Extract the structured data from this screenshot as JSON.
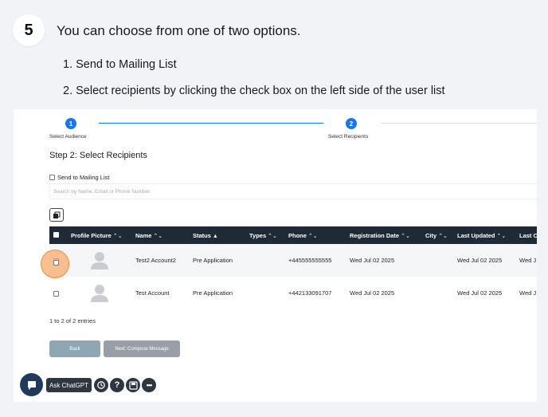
{
  "guide": {
    "step_number": "5",
    "instruction": "You can choose from one of two options.",
    "options": [
      "1. Send to Mailing List",
      "2. Select recipients by clicking the check box on the left side of the user list"
    ]
  },
  "wizard": {
    "steps": [
      {
        "number": "1",
        "label": "Select Audience"
      },
      {
        "number": "2",
        "label": "Select Recipients"
      }
    ]
  },
  "page": {
    "title": "Step 2: Select Recipients",
    "mailing_list_label": "Send to Mailing List",
    "search_placeholder": "Search by Name, Email or Phone Number"
  },
  "table": {
    "columns": [
      {
        "label": "Profile Picture",
        "sort": "⌃⌄"
      },
      {
        "label": "Name",
        "sort": "⌃⌄"
      },
      {
        "label": "Status",
        "sort": "▲"
      },
      {
        "label": "Types",
        "sort": "⌃⌄"
      },
      {
        "label": "Phone",
        "sort": "⌃⌄"
      },
      {
        "label": "Registration Date",
        "sort": "⌃⌄"
      },
      {
        "label": "City",
        "sort": "⌃⌄"
      },
      {
        "label": "Last Updated",
        "sort": "⌃⌄"
      },
      {
        "label": "Last C",
        "sort": ""
      }
    ],
    "rows": [
      {
        "name": "Test2 Account2",
        "status": "Pre Application",
        "types": "",
        "phone": "+445555555555",
        "registration_date": "Wed Jul 02 2025",
        "city": "",
        "last_updated": "Wed Jul 02 2025",
        "last_contacted": "Wed J"
      },
      {
        "name": "Test Account",
        "status": "Pre Application",
        "types": "",
        "phone": "+442133091707",
        "registration_date": "Wed Jul 02 2025",
        "city": "",
        "last_updated": "Wed Jul 02 2025",
        "last_contacted": "Wed J"
      }
    ],
    "entries_info": "1 to 2 of 2 entries"
  },
  "buttons": {
    "back": "Back",
    "next": "Next: Compose Message"
  },
  "toolbar": {
    "ask_label": "Ask ChatGPT",
    "icons": [
      "history-icon",
      "help-icon",
      "save-icon",
      "more-icon"
    ]
  },
  "colors": {
    "accent": "#1776e8",
    "table_header": "#1f2a37",
    "highlight": "#f28a3f",
    "back_button": "#8fa7b4",
    "next_button": "#999fa6"
  }
}
